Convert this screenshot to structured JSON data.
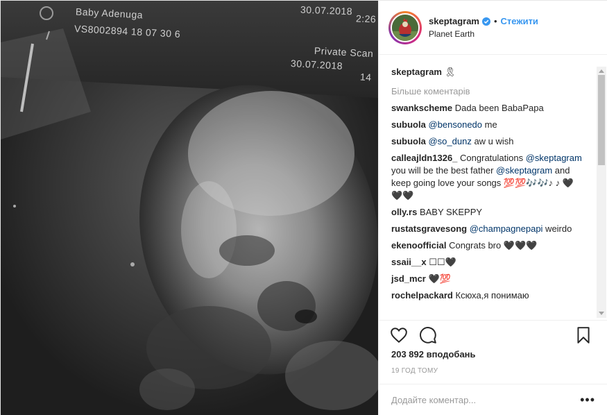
{
  "photo": {
    "scan_name": "Baby Adenuga",
    "scan_id": "VS8002894 18 07 30 6",
    "scan_date_top": "30.07.2018",
    "scan_time": "2:26",
    "scan_label": "Private Scan",
    "scan_date_bottom": "30.07.2018",
    "scan_num": "14"
  },
  "header": {
    "username": "skeptagram",
    "dot": "•",
    "follow_label": "Стежити",
    "location": "Planet Earth"
  },
  "caption": {
    "username": "skeptagram",
    "text": "🎗"
  },
  "more_comments_label": "Більше коментарів",
  "comments": [
    {
      "user": "swankscheme",
      "text": "Dada been BabaPapa"
    },
    {
      "user": "subuola",
      "mention": "@bensonedo",
      "text": " me"
    },
    {
      "user": "subuola",
      "mention": "@so_dunz",
      "text": " aw u wish"
    },
    {
      "user": "calleajldn1326_",
      "text_a": "Congratulations ",
      "mention_a": "@skeptagram",
      "text_b": " you will be the best father ",
      "mention_b": "@skeptagram",
      "text_c": " and keep going love your songs 💯💯🎶🎶♪ ♪ 🖤🖤🖤"
    },
    {
      "user": "olly.rs",
      "text": "BABY SKEPPY"
    },
    {
      "user": "rustatsgravesong",
      "mention": "@champagnepapi",
      "text": " weirdo"
    },
    {
      "user": "ekenoofficial",
      "text": "Congrats bro 🖤🖤🖤"
    },
    {
      "user": "ssaii__x",
      "text": "☐☐🖤"
    },
    {
      "user": "jsd_mcr",
      "text": "🖤💯"
    },
    {
      "user": "rochelpackard",
      "text": "Ксюха,я понимаю"
    }
  ],
  "likes_text": "203 892 вподобань",
  "time_text": "19 ГОД ТОМУ",
  "comment_input": {
    "placeholder": "Додайте коментар..."
  },
  "more_options": "•••",
  "colors": {
    "accent": "#3897f0",
    "mention": "#003569",
    "muted": "#999999"
  }
}
